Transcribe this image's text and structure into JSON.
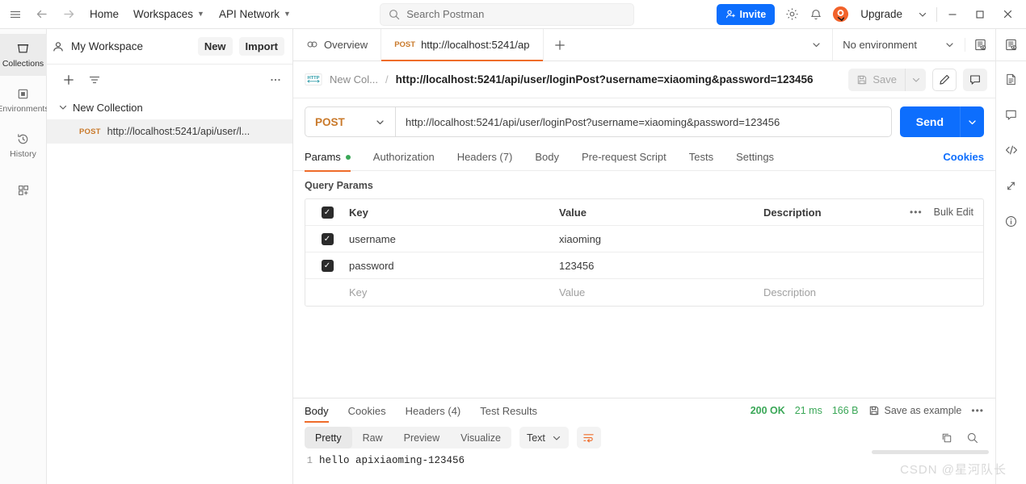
{
  "header": {
    "hamburger_icon": "menu-icon",
    "back_icon": "arrow-left-icon",
    "forward_icon": "arrow-right-icon",
    "home_label": "Home",
    "workspaces_label": "Workspaces",
    "api_network_label": "API Network",
    "search_placeholder": "Search Postman",
    "invite_label": "Invite",
    "settings_icon": "gear-icon",
    "notifications_icon": "bell-icon",
    "account_icon": "avatar-icon",
    "upgrade_label": "Upgrade",
    "minimize_label": "—",
    "maximize_label": "□",
    "close_label": "✕",
    "accent_blue": "#0d6efd"
  },
  "rail": {
    "items": [
      {
        "label": "Collections",
        "icon": "collections-icon",
        "active": true
      },
      {
        "label": "Environments",
        "icon": "environments-icon",
        "active": false
      },
      {
        "label": "History",
        "icon": "history-icon",
        "active": false
      },
      {
        "label": "",
        "icon": "add-module-icon",
        "active": false
      }
    ]
  },
  "sidebar": {
    "workspace_name": "My Workspace",
    "workspace_icon": "user-icon",
    "new_label": "New",
    "import_label": "Import",
    "add_icon": "plus-icon",
    "filter_icon": "filter-icon",
    "more_icon": "ellipsis-icon",
    "collection": {
      "chevron_icon": "chevron-down-icon",
      "name": "New Collection",
      "request": {
        "method": "POST",
        "url": "http://localhost:5241/api/user/l..."
      }
    }
  },
  "tabstrip": {
    "overview_label": "Overview",
    "overview_icon": "overview-icon",
    "request_tab": {
      "method": "POST",
      "url": "http://localhost:5241/ap"
    },
    "new_tab_label": "+",
    "chevron_icon": "chevron-down-icon",
    "environment_label": "No environment",
    "eye_icon": "eye-env-icon"
  },
  "breadcrumb": {
    "protocol_icon": "http-icon",
    "collection_label": "New Col...",
    "separator": "/",
    "request_name": "http://localhost:5241/api/user/loginPost?username=xiaoming&password=123456",
    "save_label": "Save",
    "save_icon": "floppy-icon",
    "save_caret_icon": "chevron-down-icon",
    "edit_icon": "pencil-icon",
    "comment_icon": "comment-icon"
  },
  "request": {
    "method": "POST",
    "method_caret_icon": "chevron-down-icon",
    "url": "http://localhost:5241/api/user/loginPost?username=xiaoming&password=123456",
    "send_label": "Send",
    "send_caret_icon": "chevron-down-icon",
    "tabs": [
      {
        "label": "Params",
        "active": true,
        "has_dot": true
      },
      {
        "label": "Authorization",
        "active": false,
        "has_dot": false
      },
      {
        "label": "Headers (7)",
        "active": false,
        "has_dot": false
      },
      {
        "label": "Body",
        "active": false,
        "has_dot": false
      },
      {
        "label": "Pre-request Script",
        "active": false,
        "has_dot": false
      },
      {
        "label": "Tests",
        "active": false,
        "has_dot": false
      },
      {
        "label": "Settings",
        "active": false,
        "has_dot": false
      }
    ],
    "cookies_label": "Cookies"
  },
  "query_params": {
    "section_title": "Query Params",
    "columns": {
      "key": "Key",
      "value": "Value",
      "description": "Description"
    },
    "rows": [
      {
        "checked": true,
        "key": "username",
        "value": "xiaoming",
        "description": ""
      },
      {
        "checked": true,
        "key": "password",
        "value": "123456",
        "description": ""
      }
    ],
    "placeholder_row": {
      "key": "Key",
      "value": "Value",
      "description": "Description"
    },
    "more_icon": "ellipsis-icon",
    "bulk_edit_label": "Bulk Edit"
  },
  "response": {
    "tabs": [
      {
        "label": "Body",
        "active": true
      },
      {
        "label": "Cookies",
        "active": false
      },
      {
        "label": "Headers (4)",
        "active": false
      },
      {
        "label": "Test Results",
        "active": false
      }
    ],
    "status": "200 OK",
    "time": "21 ms",
    "size": "166 B",
    "save_example_label": "Save as example",
    "save_example_icon": "floppy-icon",
    "more_icon": "ellipsis-icon",
    "format_tabs": [
      {
        "label": "Pretty",
        "active": true
      },
      {
        "label": "Raw",
        "active": false
      },
      {
        "label": "Preview",
        "active": false
      },
      {
        "label": "Visualize",
        "active": false
      }
    ],
    "content_type": "Text",
    "content_type_caret_icon": "chevron-down-icon",
    "wrap_icon": "wrap-lines-icon",
    "copy_icon": "copy-icon",
    "search_icon": "search-icon",
    "line_number": "1",
    "body_text": "hello apixiaoming-123456"
  },
  "right_rail": {
    "icons": [
      "env-quick-look-icon",
      "documentation-icon",
      "comments-icon",
      "code-snippet-icon",
      "changelog-icon",
      "info-icon"
    ]
  },
  "watermark": "CSDN @星河队长"
}
